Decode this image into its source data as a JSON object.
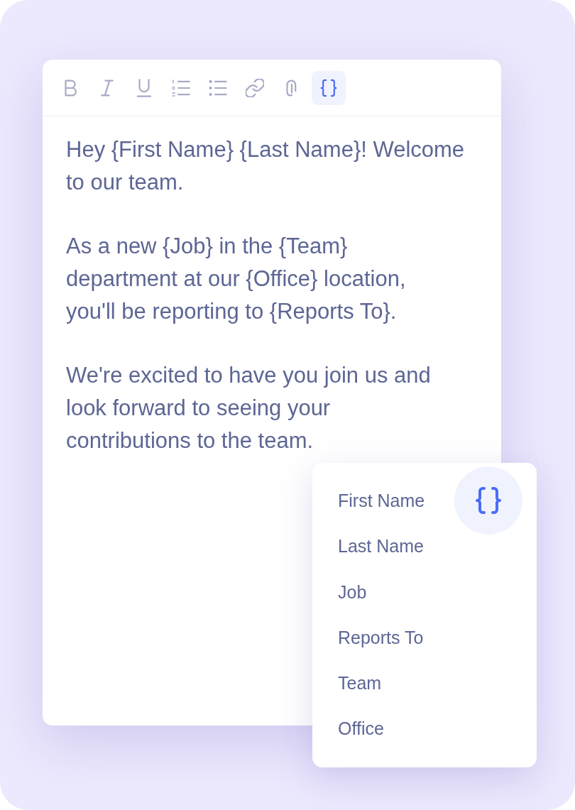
{
  "toolbar": {
    "buttons": [
      {
        "kind": "bold",
        "selected": false
      },
      {
        "kind": "italic",
        "selected": false
      },
      {
        "kind": "underline",
        "selected": false
      },
      {
        "kind": "numbered_list",
        "selected": false
      },
      {
        "kind": "bullet_list",
        "selected": false
      },
      {
        "kind": "link",
        "selected": false
      },
      {
        "kind": "attachment",
        "selected": false
      },
      {
        "kind": "variable",
        "selected": true
      }
    ]
  },
  "editor": {
    "paragraphs": [
      "Hey {First Name} {Last Name}! Welcome\nto our team.",
      "As a new {Job} in the {Team}\ndepartment at our {Office} location,\nyou'll be reporting to {Reports To}.",
      "We're excited to have you join us and\nlook forward to seeing your\ncontributions to the team."
    ]
  },
  "variable_menu": {
    "items": [
      "First Name",
      "Last Name",
      "Job",
      "Reports To",
      "Team",
      "Office"
    ]
  }
}
